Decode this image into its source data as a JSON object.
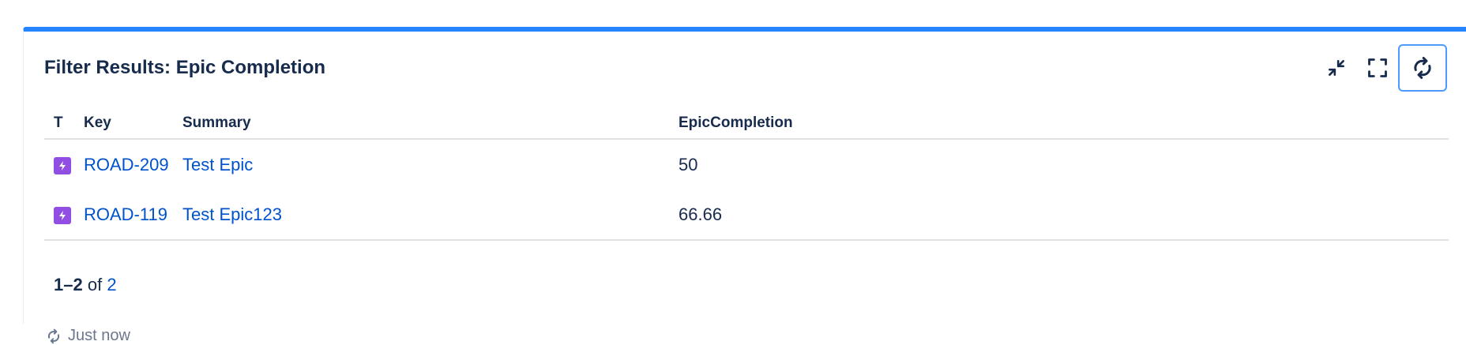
{
  "gadget": {
    "title": "Filter Results: Epic Completion",
    "toolbar": {
      "minimize_icon": "minimize-arrows-icon",
      "fullscreen_icon": "fullscreen-corners-icon",
      "refresh_icon": "refresh-icon"
    },
    "accent_color": "#2684ff",
    "link_color": "#0052cc",
    "epic_icon_color": "#904ee2"
  },
  "table": {
    "headers": {
      "type": "T",
      "key": "Key",
      "summary": "Summary",
      "epic_completion": "EpicCompletion"
    },
    "rows": [
      {
        "type_icon": "epic-lightning-icon",
        "key": "ROAD-209",
        "summary": "Test Epic",
        "epic_completion": "50"
      },
      {
        "type_icon": "epic-lightning-icon",
        "key": "ROAD-119",
        "summary": "Test Epic123",
        "epic_completion": "66.66"
      }
    ]
  },
  "pagination": {
    "range": "1–2",
    "of_text": "of",
    "total": "2"
  },
  "footer": {
    "refresh_icon": "refresh-icon",
    "updated_text": "Just now"
  }
}
